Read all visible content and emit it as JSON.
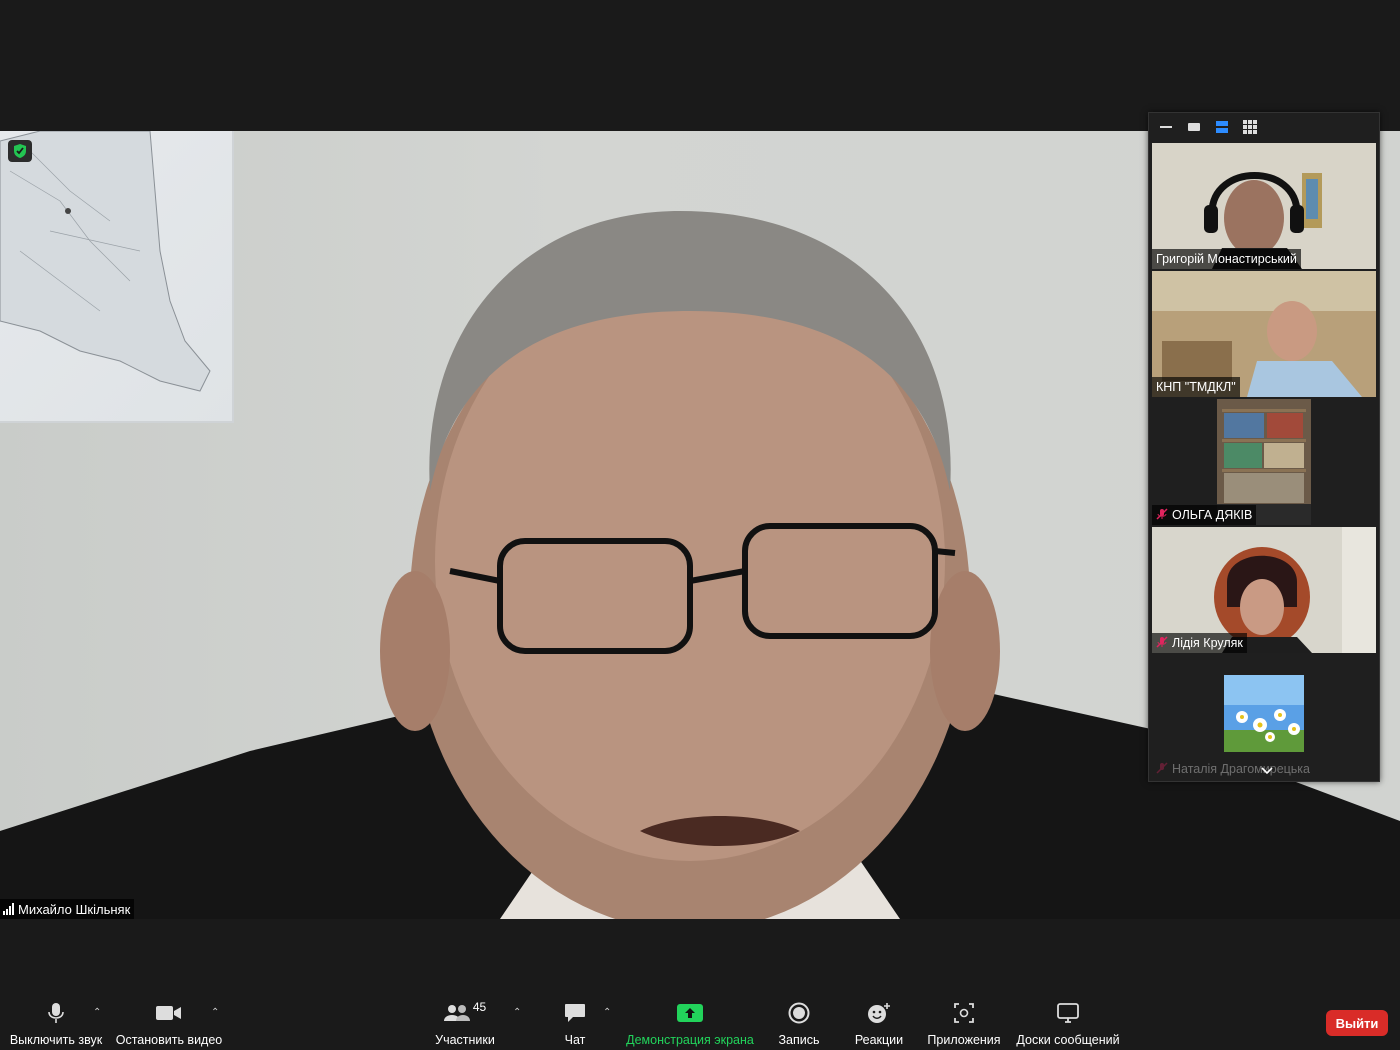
{
  "main_speaker": {
    "name": "Михайло Шкільняк"
  },
  "gallery": {
    "tiles": [
      {
        "name": "Григорій Монастирський",
        "muted": false
      },
      {
        "name": "КНП \"ТМДКЛ\"",
        "muted": false
      },
      {
        "name": "ОЛЬГА ДЯКІВ",
        "muted": true
      },
      {
        "name": "Лідія Круляк",
        "muted": true
      },
      {
        "name": "Наталія Драгомирецька",
        "muted": true
      }
    ]
  },
  "toolbar": {
    "mute_label": "Выключить звук",
    "video_label": "Остановить видео",
    "participants_label": "Участники",
    "participants_count": "45",
    "chat_label": "Чат",
    "share_label": "Демонстрация экрана",
    "record_label": "Запись",
    "reactions_label": "Реакции",
    "apps_label": "Приложения",
    "whiteboards_label": "Доски сообщений",
    "exit_label": "Выйти"
  },
  "colors": {
    "share_green": "#22d35b",
    "exit_red": "#d92c28",
    "layout_active": "#2d8cff"
  }
}
